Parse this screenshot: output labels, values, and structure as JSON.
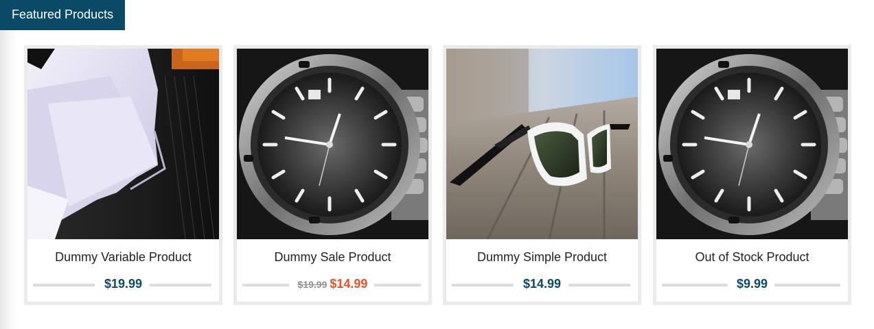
{
  "section": {
    "title": "Featured Products"
  },
  "products": [
    {
      "name": "Dummy Variable Product",
      "image": "shirt-collar-image",
      "price": "$19.99"
    },
    {
      "name": "Dummy Sale Product",
      "image": "watch-image",
      "old_price": "$19.99",
      "sale_price": "$14.99"
    },
    {
      "name": "Dummy Simple Product",
      "image": "sunglasses-image",
      "price": "$14.99"
    },
    {
      "name": "Out of Stock Product",
      "image": "watch-image",
      "price": "$9.99"
    }
  ],
  "colors": {
    "accent": "#0b4a66",
    "sale": "#f04e23",
    "muted": "#8e8e8e",
    "card_border": "#ebebeb"
  }
}
